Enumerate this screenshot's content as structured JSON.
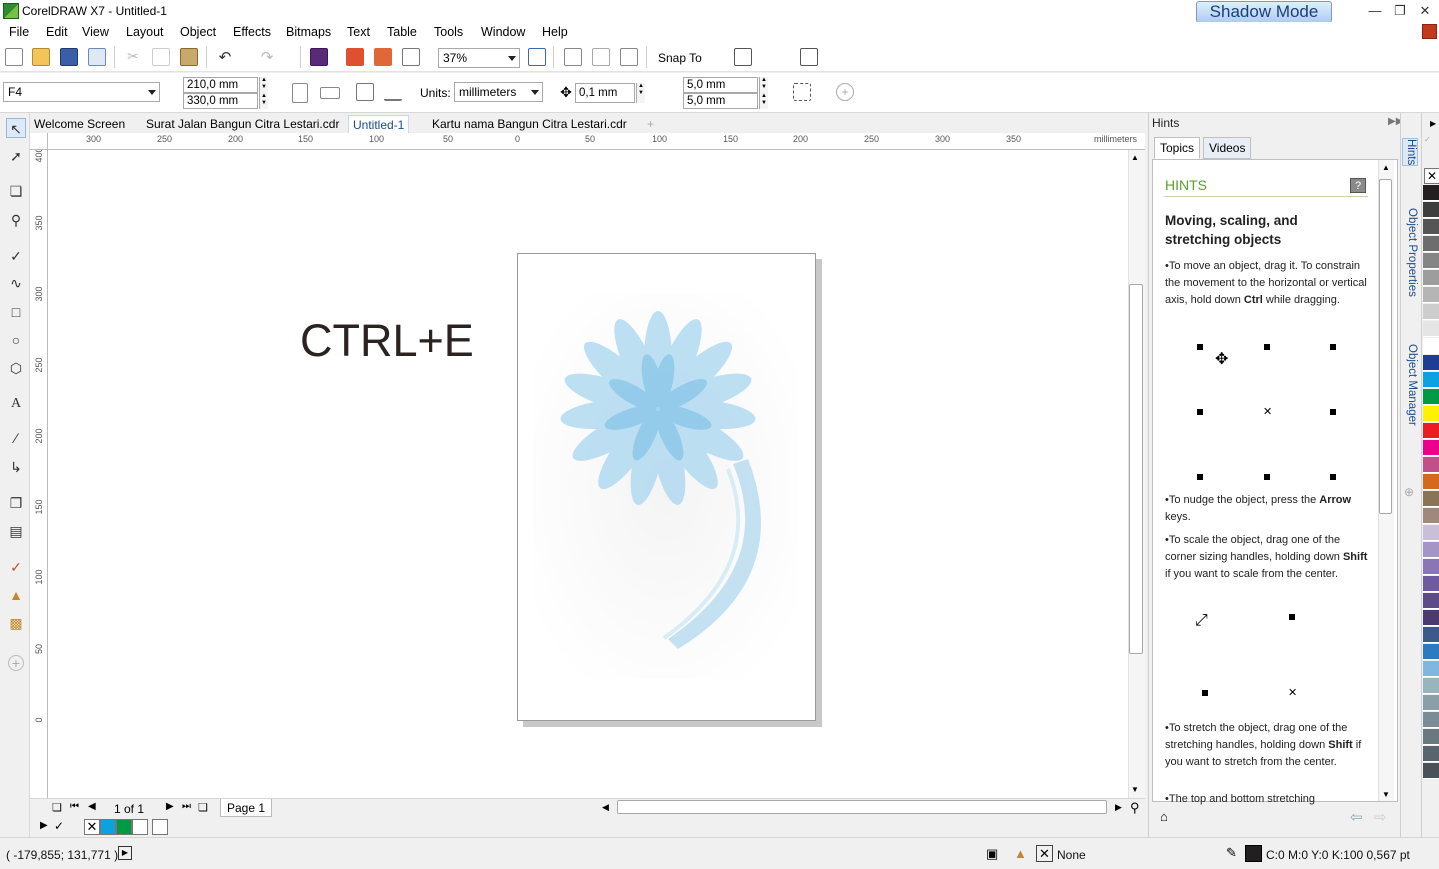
{
  "window": {
    "title": "CorelDRAW X7 - Untitled-1",
    "shadow_mode_label": "Shadow Mode"
  },
  "menu": [
    "File",
    "Edit",
    "View",
    "Layout",
    "Object",
    "Effects",
    "Bitmaps",
    "Text",
    "Table",
    "Tools",
    "Window",
    "Help"
  ],
  "toolbar": {
    "zoom": "37%",
    "snap_to": "Snap To"
  },
  "property_bar": {
    "page_size": "F4",
    "width": "210,0 mm",
    "height": "330,0 mm",
    "units_label": "Units:",
    "units": "millimeters",
    "nudge": "0,1 mm",
    "dup_x": "5,0 mm",
    "dup_y": "5,0 mm"
  },
  "doc_tabs": [
    "Welcome Screen",
    "Surat Jalan Bangun Citra Lestari.cdr",
    "Untitled-1",
    "Kartu nama Bangun Citra Lestari.cdr"
  ],
  "active_tab": "Untitled-1",
  "ruler": {
    "h_labels": [
      "300",
      "250",
      "200",
      "150",
      "100",
      "50",
      "0",
      "50",
      "100",
      "150",
      "200",
      "250",
      "300",
      "350"
    ],
    "v_labels": [
      "400",
      "350",
      "300",
      "250",
      "200",
      "150",
      "100",
      "50",
      "0"
    ],
    "unit": "millimeters"
  },
  "canvas": {
    "shortcut_text": "CTRL+E"
  },
  "page_nav": {
    "count": "1 of 1",
    "page_tab": "Page 1"
  },
  "hints": {
    "panel_title": "Hints",
    "tabs": [
      "Topics",
      "Videos"
    ],
    "heading": "HINTS",
    "help_icon_label": "?",
    "topic": "Moving, scaling, and stretching objects",
    "p1_pre": "To move an object, drag it. To constrain the movement to the horizontal or vertical axis, hold down ",
    "p1_key": "Ctrl",
    "p1_post": " while dragging.",
    "p2_pre": "To nudge the object, press the ",
    "p2_key": "Arrow",
    "p2_post": " keys.",
    "p3_pre": "To scale the object, drag one of the corner sizing handles, holding down ",
    "p3_key": "Shift",
    "p3_post": " if you want to scale from the center.",
    "p4_pre": "To stretch the object, drag one of the stretching handles, holding down ",
    "p4_key": "Shift",
    "p4_post": " if you want to stretch from the center.",
    "p5": "The top and bottom stretching"
  },
  "docker_tabs": [
    "Hints",
    "Object Properties",
    "Object Manager"
  ],
  "palette_colors": [
    "#231f20",
    "#3d3d3d",
    "#555555",
    "#6d6d6d",
    "#858585",
    "#9d9d9d",
    "#b5b5b5",
    "#cdcdcd",
    "#e5e5e5",
    "#ffffff",
    "#1c3f94",
    "#0aa2e0",
    "#009a45",
    "#fff200",
    "#ed1c24",
    "#ec008c",
    "#c0508a",
    "#d2691e",
    "#8b7355",
    "#a0897a",
    "#c9bfd8",
    "#a595c6",
    "#8a76b4",
    "#6e5aa0",
    "#5d4a88",
    "#4b3a70",
    "#3b5a8a",
    "#2c7bc0",
    "#7fb7e0",
    "#98b4bc",
    "#8aa0a8",
    "#7a8c94",
    "#6a7880",
    "#5a646c",
    "#4a5058"
  ],
  "doc_palette": [
    "#0aa2e0",
    "#009a45",
    "#ffffff"
  ],
  "status": {
    "coords": "( -179,855; 131,771 )",
    "fill": "None",
    "outline": "C:0 M:0 Y:0 K:100  0,567 pt"
  }
}
